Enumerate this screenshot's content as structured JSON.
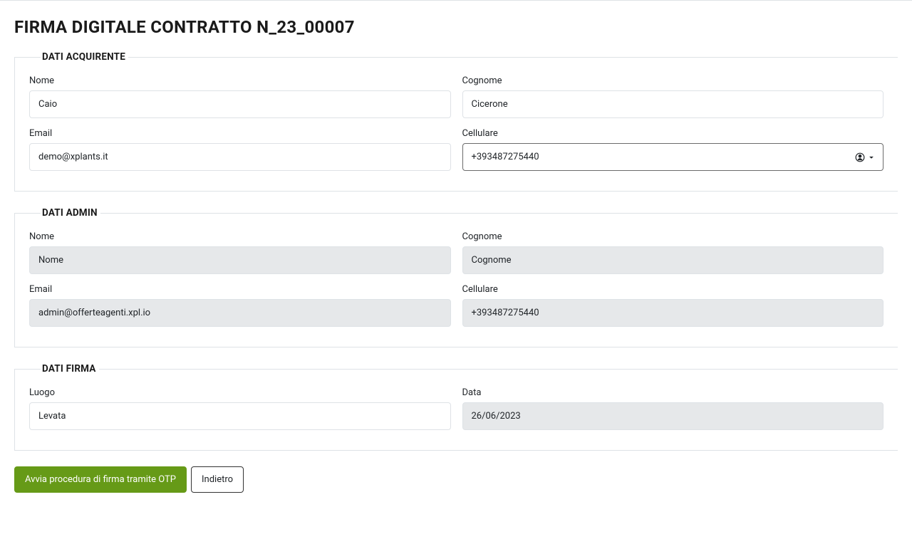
{
  "page": {
    "title": "FIRMA DIGITALE CONTRATTO N_23_00007"
  },
  "acquirente": {
    "legend": "DATI ACQUIRENTE",
    "nome_label": "Nome",
    "nome_value": "Caio",
    "cognome_label": "Cognome",
    "cognome_value": "Cicerone",
    "email_label": "Email",
    "email_value": "demo@xplants.it",
    "cellulare_label": "Cellulare",
    "cellulare_value": "+393487275440"
  },
  "admin": {
    "legend": "DATI ADMIN",
    "nome_label": "Nome",
    "nome_placeholder": "Nome",
    "cognome_label": "Cognome",
    "cognome_placeholder": "Cognome",
    "email_label": "Email",
    "email_value": "admin@offerteagenti.xpl.io",
    "cellulare_label": "Cellulare",
    "cellulare_value": "+393487275440"
  },
  "firma": {
    "legend": "DATI FIRMA",
    "luogo_label": "Luogo",
    "luogo_value": "Levata",
    "data_label": "Data",
    "data_value": "26/06/2023"
  },
  "buttons": {
    "avvia_label": "Avvia procedura di firma tramite OTP",
    "indietro_label": "Indietro"
  }
}
